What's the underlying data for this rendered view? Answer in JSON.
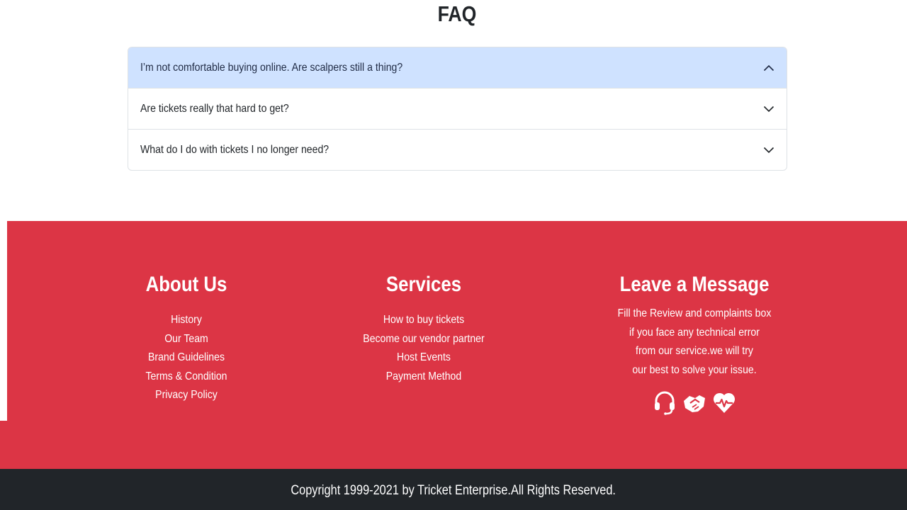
{
  "faq": {
    "title": "FAQ",
    "items": [
      {
        "question": "I’m not comfortable buying online. Are scalpers still a thing?",
        "expanded": true
      },
      {
        "question": "Are tickets really that hard to get?",
        "expanded": false
      },
      {
        "question": "What do I do with tickets I no longer need?",
        "expanded": false
      }
    ]
  },
  "footer": {
    "about": {
      "heading": "About Us",
      "links": [
        "History",
        "Our Team",
        "Brand Guidelines",
        "Terms & Condition",
        "Privacy Policy"
      ]
    },
    "services": {
      "heading": "Services",
      "links": [
        "How to buy tickets",
        "Become our vendor partner",
        "Host Events",
        "Payment Method"
      ]
    },
    "message": {
      "heading": "Leave a Message",
      "lines": [
        "Fill the Review and complaints box",
        "if you face any technical error",
        "from our service.we will try",
        "our best to solve your issue."
      ],
      "icons": [
        "headset-icon",
        "handshake-icon",
        "heart-pulse-icon"
      ]
    },
    "copyright": "Copyright 1999-2021 by Tricket Enterprise.All Rights Reserved."
  },
  "colors": {
    "accent_red": "#dc3545",
    "accordion_open_bg": "#cfe2ff",
    "copyright_bg": "#212529"
  }
}
